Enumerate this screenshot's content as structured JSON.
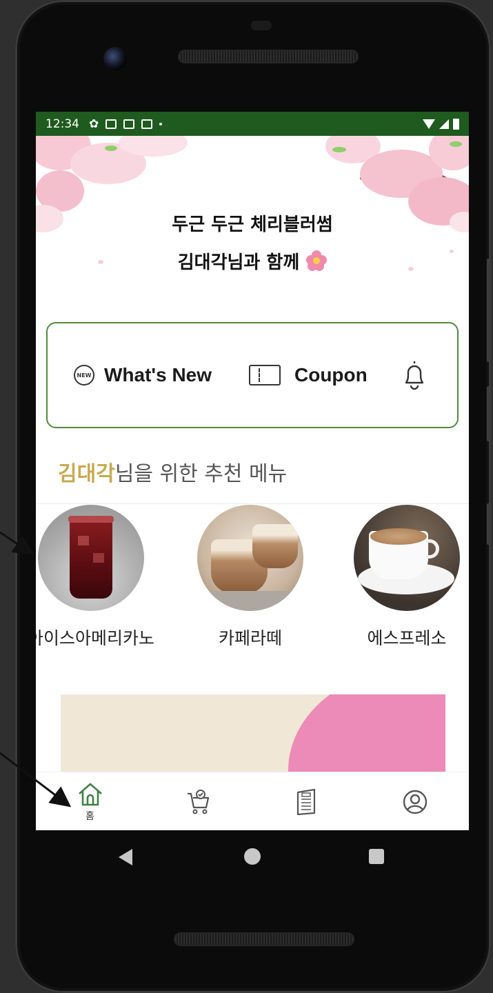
{
  "status_bar": {
    "time": "12:34"
  },
  "hero": {
    "line1": "두근 두근 체리블러썸",
    "line2": "김대각님과 함께"
  },
  "quick_actions": {
    "new_badge": "NEW",
    "whats_new": "What's New",
    "coupon": "Coupon"
  },
  "recommend": {
    "name": "김대각",
    "suffix": "님을 위한 추천 메뉴"
  },
  "menu_items": [
    {
      "label": "아이스아메리카노"
    },
    {
      "label": "카페라떼"
    },
    {
      "label": "에스프레소"
    }
  ],
  "nav": {
    "home_label": "홈"
  },
  "colors": {
    "status_bar": "#1f5a1e",
    "accent_green": "#4f8a3e",
    "name_gold": "#c7a94e",
    "banner_pink": "#ec8ab8",
    "banner_cream": "#f1e7d6"
  }
}
